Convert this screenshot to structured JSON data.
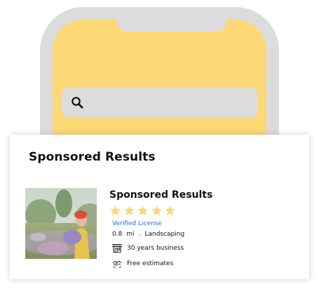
{
  "colors": {
    "phone_frame": "#dcdcdc",
    "phone_screen": "#fdd876",
    "search_bar": "#dcdcdc",
    "star": "#fdd876",
    "link": "#2a6fc9"
  },
  "phone": {
    "search": {
      "icon": "search-icon"
    }
  },
  "card": {
    "title": "Sponsored Results",
    "listing": {
      "title": "Sponsored Results",
      "rating": 5,
      "rating_max": 5,
      "license": "Verified License",
      "distance_value": "0.8",
      "distance_unit": "mi",
      "separator": ".",
      "category": "Landscaping",
      "features": [
        {
          "icon": "storefront-icon",
          "label": "30 years business"
        },
        {
          "icon": "handshake-icon",
          "label": "Free estimates"
        }
      ]
    }
  }
}
